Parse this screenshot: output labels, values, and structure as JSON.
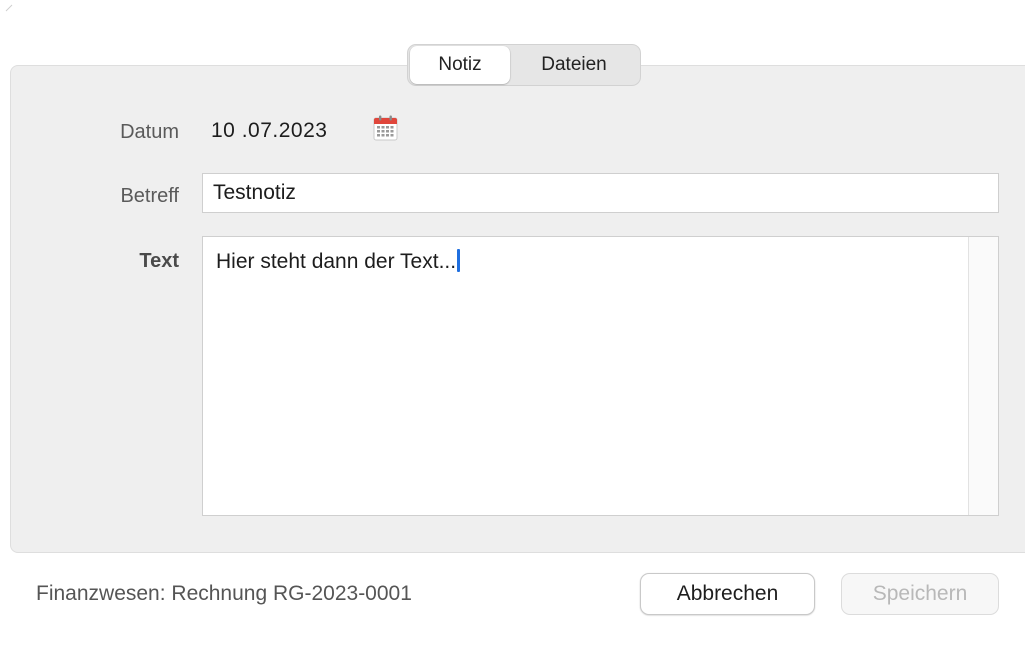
{
  "tabs": [
    {
      "label": "Notiz",
      "active": true
    },
    {
      "label": "Dateien",
      "active": false
    }
  ],
  "form": {
    "date_label": "Datum",
    "date_value": "10 .07.2023",
    "subject_label": "Betreff",
    "subject_value": "Testnotiz",
    "text_label": "Text",
    "text_value": "Hier steht dann der Text..."
  },
  "footer": {
    "context": "Finanzwesen: Rechnung RG-2023-0001",
    "cancel_label": "Abbrechen",
    "save_label": "Speichern",
    "save_enabled": false
  },
  "icons": {
    "calendar": "calendar-icon"
  },
  "colors": {
    "calendar_red": "#e0463b",
    "caret_blue": "#1f6fe0",
    "panel_bg": "#efefef"
  }
}
